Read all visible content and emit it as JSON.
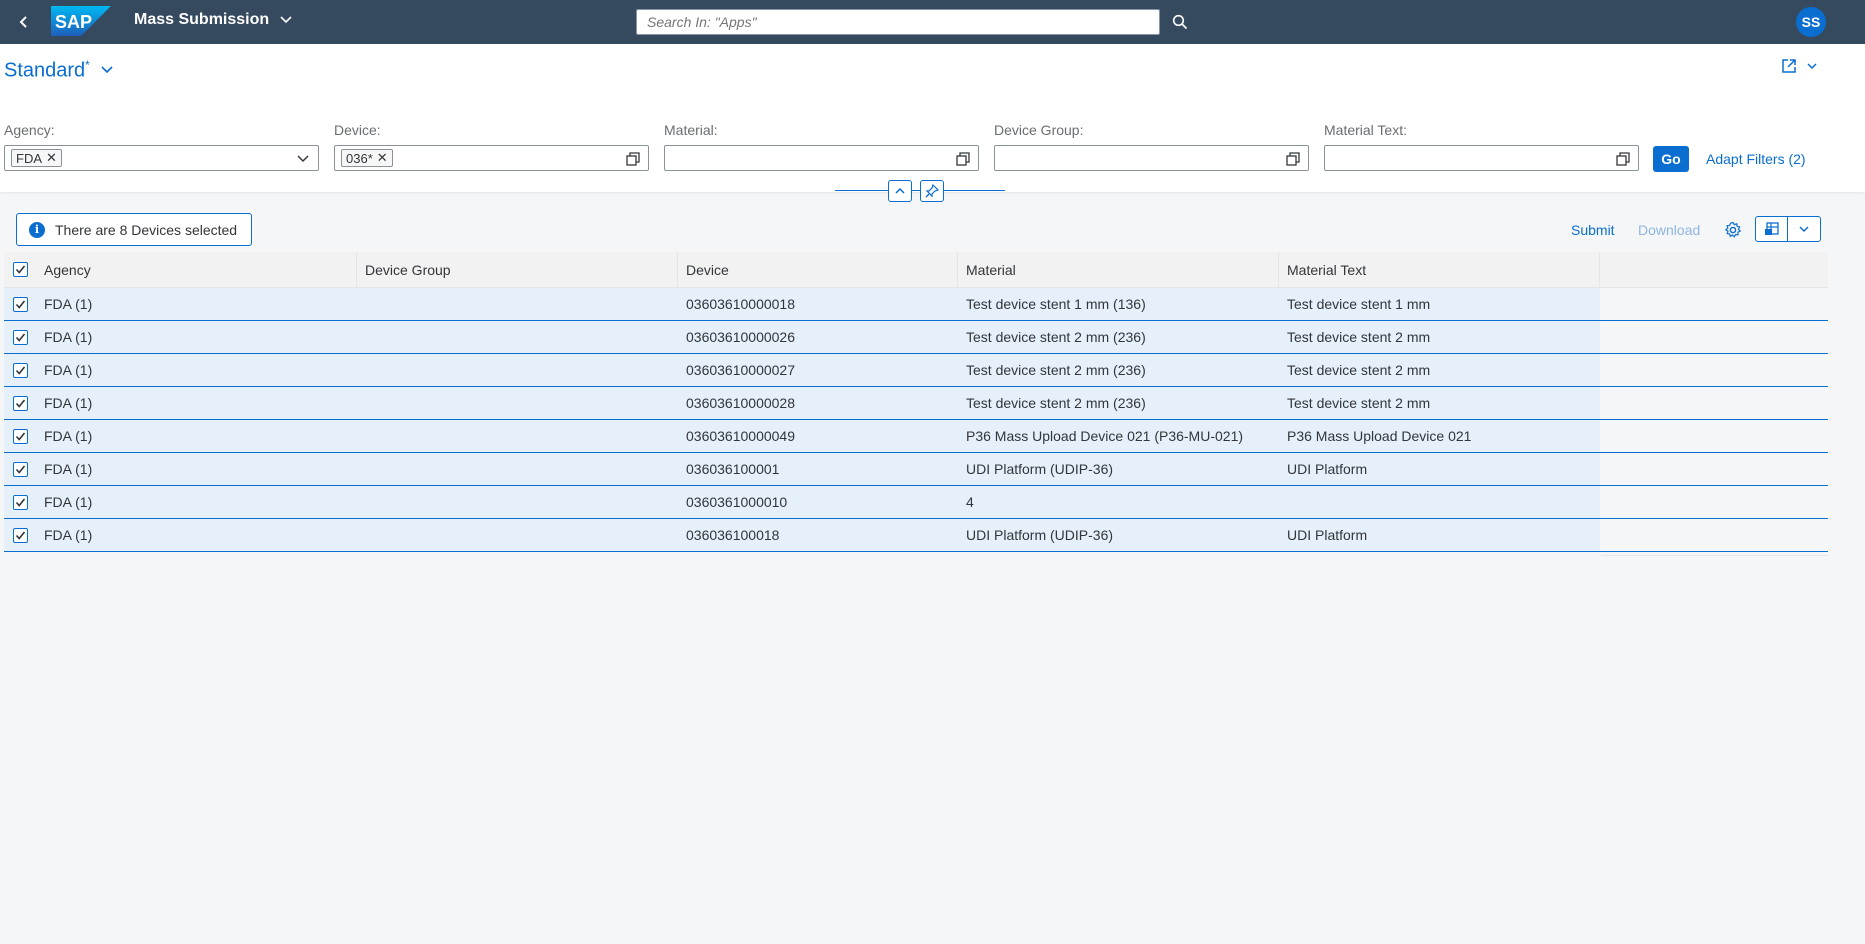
{
  "shell": {
    "logo_text": "SAP",
    "app_title": "Mass Submission",
    "search_placeholder": "Search In: \"Apps\"",
    "avatar_initials": "SS"
  },
  "header": {
    "variant_name": "Standard",
    "variant_modified_marker": "*"
  },
  "filters": {
    "agency": {
      "label": "Agency:",
      "tokens": [
        "FDA"
      ]
    },
    "device": {
      "label": "Device:",
      "tokens": [
        "036*"
      ]
    },
    "material": {
      "label": "Material:",
      "value": ""
    },
    "device_group": {
      "label": "Device Group:",
      "value": ""
    },
    "material_text": {
      "label": "Material Text:",
      "value": ""
    },
    "go_label": "Go",
    "adapt_label": "Adapt Filters (2)"
  },
  "toolbar": {
    "message": "There are 8 Devices selected",
    "submit_label": "Submit",
    "download_label": "Download"
  },
  "table": {
    "columns": [
      "Agency",
      "Device Group",
      "Device",
      "Material",
      "Material Text"
    ],
    "rows": [
      {
        "agency": "FDA (1)",
        "group": "",
        "device": "03603610000018",
        "material": "Test device stent 1 mm (136)",
        "mtext": "Test device stent 1 mm"
      },
      {
        "agency": "FDA (1)",
        "group": "",
        "device": "03603610000026",
        "material": "Test device stent 2 mm (236)",
        "mtext": "Test device stent 2 mm"
      },
      {
        "agency": "FDA (1)",
        "group": "",
        "device": "03603610000027",
        "material": "Test device stent 2 mm (236)",
        "mtext": "Test device stent 2 mm"
      },
      {
        "agency": "FDA (1)",
        "group": "",
        "device": "03603610000028",
        "material": "Test device stent 2 mm (236)",
        "mtext": "Test device stent 2 mm"
      },
      {
        "agency": "FDA (1)",
        "group": "",
        "device": "03603610000049",
        "material": "P36 Mass Upload Device 021 (P36-MU-021)",
        "mtext": "P36 Mass Upload Device 021"
      },
      {
        "agency": "FDA (1)",
        "group": "",
        "device": "036036100001",
        "material": "UDI Platform (UDIP-36)",
        "mtext": "UDI Platform"
      },
      {
        "agency": "FDA (1)",
        "group": "",
        "device": "0360361000010",
        "material": "4",
        "mtext": ""
      },
      {
        "agency": "FDA (1)",
        "group": "",
        "device": "036036100018",
        "material": "UDI Platform (UDIP-36)",
        "mtext": "UDI Platform"
      }
    ]
  },
  "colors": {
    "shell": "#354a5f",
    "brand": "#0a6ed1",
    "selected_row": "#e5f0fa"
  },
  "icons": [
    "back-icon",
    "chevron-down-icon",
    "search-icon",
    "share-icon",
    "value-help-icon",
    "collapse-icon",
    "pin-icon",
    "info-icon",
    "gear-icon",
    "export-icon",
    "checkbox-checked-icon"
  ]
}
